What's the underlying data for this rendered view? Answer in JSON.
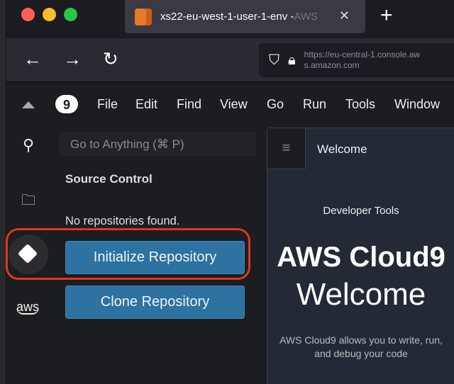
{
  "browser": {
    "tab_title": "xs22-eu-west-1-user-1-env - ",
    "tab_title_faded": "AWS",
    "url": "https://eu-central-1.console.aws.amazon.com",
    "window_controls": {
      "close": "#ff5f57",
      "minimize": "#febc2e",
      "zoom": "#28c840"
    }
  },
  "menu": {
    "items": [
      "File",
      "Edit",
      "Find",
      "View",
      "Go",
      "Run",
      "Tools",
      "Window"
    ]
  },
  "panel": {
    "search_placeholder": "Go to Anything (⌘ P)",
    "title": "Source Control",
    "empty_text": "No repositories found.",
    "init_button": "Initialize Repository",
    "clone_button": "Clone Repository"
  },
  "sidebar": {
    "aws_label": "aws"
  },
  "editor": {
    "tab": "Welcome",
    "developer_text": "Developer Tools",
    "heading1": "AWS Cloud9",
    "heading2": "Welcome",
    "body": "AWS Cloud9 allows you to write, run, and debug your code"
  },
  "colors": {
    "accent_button": "#2d72a0",
    "highlight": "#e4341d",
    "tab_icon": "#e8782a"
  }
}
